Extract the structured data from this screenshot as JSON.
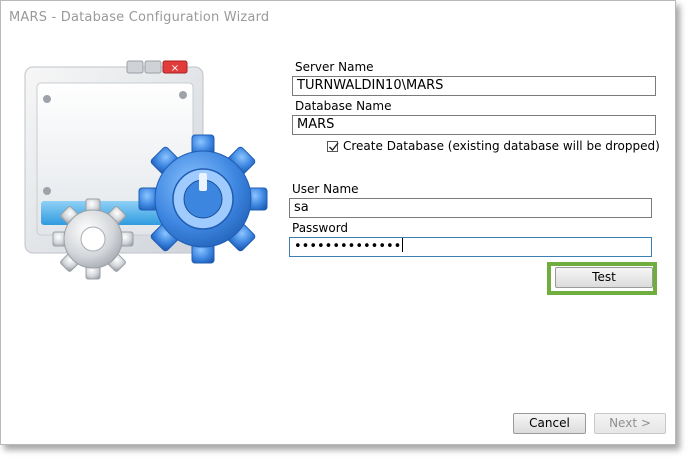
{
  "window": {
    "title": "MARS - Database Configuration Wizard"
  },
  "form": {
    "server_name_label": "Server Name",
    "server_name_value": "TURNWALDIN10\\MARS",
    "database_name_label": "Database Name",
    "database_name_value": "MARS",
    "create_database_checked": true,
    "create_database_label": "Create Database (existing database will be dropped)",
    "user_name_label": "User Name",
    "user_name_value": "sa",
    "password_label": "Password",
    "password_value": "••••••••••••••"
  },
  "buttons": {
    "test": "Test",
    "cancel": "Cancel",
    "next": "Next >"
  },
  "colors": {
    "highlight": "#6fae3e",
    "focus_border": "#3c7fb1",
    "gear_blue": "#3d86e0"
  },
  "icons": {
    "illustration": "database-config-window-gears-illustration"
  }
}
